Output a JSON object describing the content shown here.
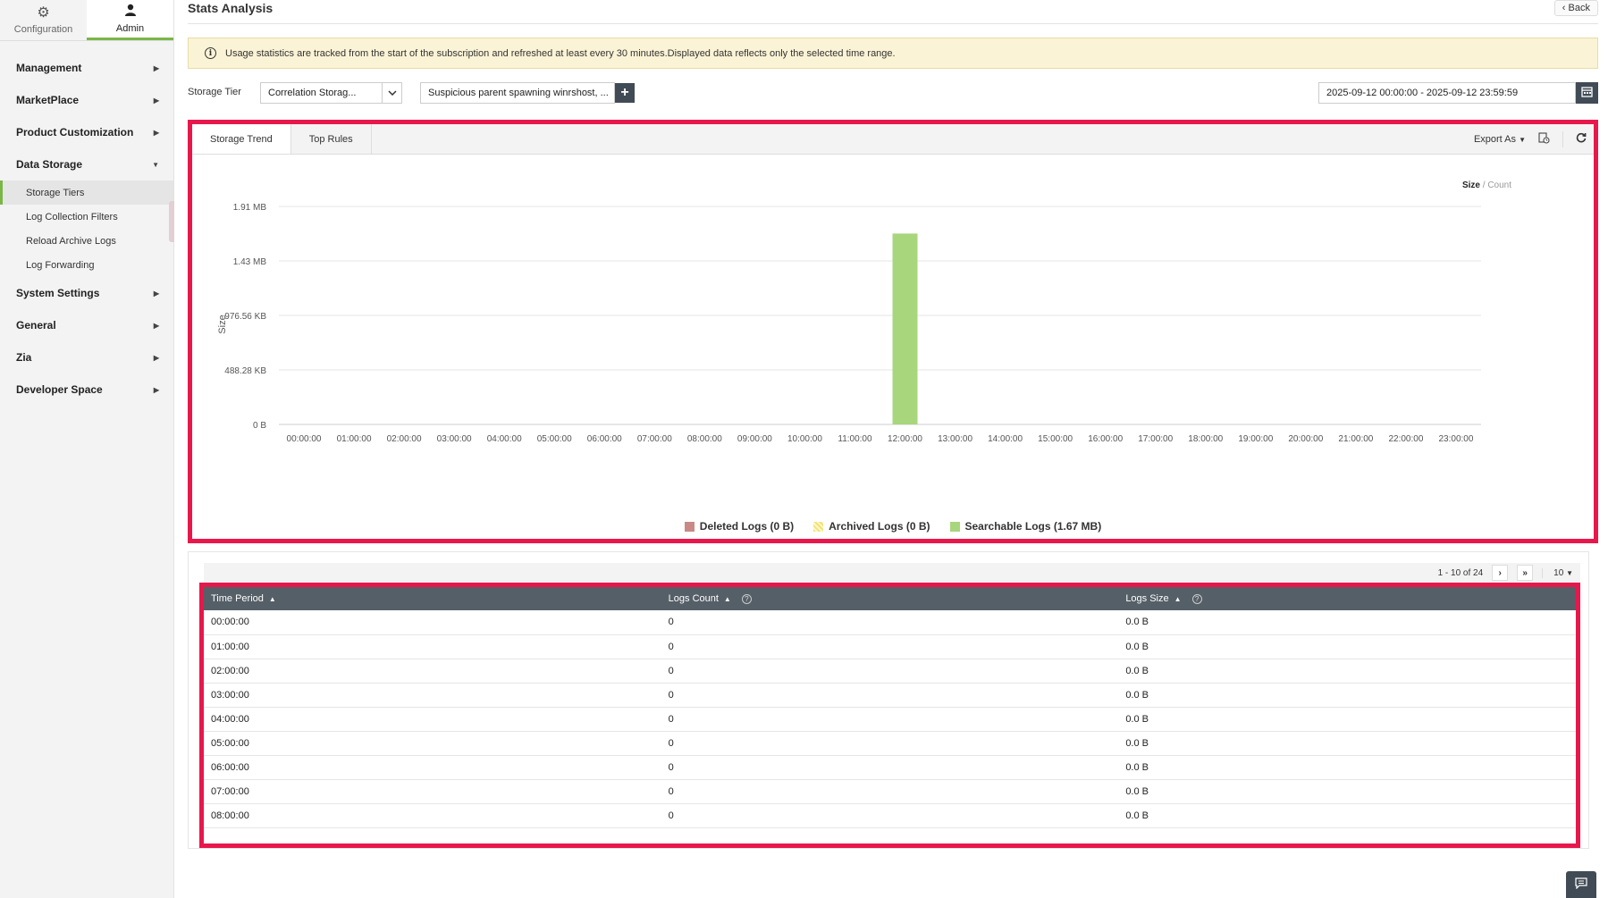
{
  "topnav": [
    {
      "label": "Configuration",
      "icon": "gear-icon",
      "active": false
    },
    {
      "label": "Admin",
      "icon": "user-icon",
      "active": true
    }
  ],
  "sidebar": {
    "items": [
      {
        "label": "Management"
      },
      {
        "label": "MarketPlace"
      },
      {
        "label": "Product Customization"
      },
      {
        "label": "Data Storage",
        "expanded": true
      },
      {
        "label": "System Settings"
      },
      {
        "label": "General"
      },
      {
        "label": "Zia"
      },
      {
        "label": "Developer Space"
      }
    ],
    "data_storage_children": [
      {
        "label": "Storage Tiers",
        "active": true
      },
      {
        "label": "Log Collection Filters"
      },
      {
        "label": "Reload Archive Logs"
      },
      {
        "label": "Log Forwarding"
      }
    ]
  },
  "header": {
    "title": "Stats Analysis",
    "back_label": "Back"
  },
  "banner": {
    "text": "Usage statistics are tracked from the start of the subscription and refreshed at least every 30 minutes.Displayed data reflects only the selected time range."
  },
  "filters": {
    "tier_label": "Storage Tier",
    "tier_value": "Correlation Storag...",
    "rule_value": "Suspicious parent spawning winrshost, ...",
    "plus_label": "+",
    "date_range": "2025-09-12 00:00:00 - 2025-09-12 23:59:59"
  },
  "tabs": [
    {
      "label": "Storage Trend",
      "active": true
    },
    {
      "label": "Top Rules",
      "active": false
    }
  ],
  "tools": {
    "export_label": "Export As"
  },
  "toggle": {
    "size": "Size",
    "sep": " / ",
    "count": "Count"
  },
  "colors": {
    "deleted": "#c98a86",
    "archived": "#f2e27a",
    "searchable": "#a8d67c",
    "highlight": "#e8174b",
    "accent": "#7ab648"
  },
  "chart_data": {
    "type": "bar",
    "stacked": true,
    "ylabel": "Size",
    "y_ticks": [
      "0 B",
      "488.28 KB",
      "976.56 KB",
      "1.43 MB",
      "1.91 MB"
    ],
    "ylim_bytes": [
      0,
      2000000
    ],
    "categories": [
      "00:00:00",
      "01:00:00",
      "02:00:00",
      "03:00:00",
      "04:00:00",
      "05:00:00",
      "06:00:00",
      "07:00:00",
      "08:00:00",
      "09:00:00",
      "10:00:00",
      "11:00:00",
      "12:00:00",
      "13:00:00",
      "14:00:00",
      "15:00:00",
      "16:00:00",
      "17:00:00",
      "18:00:00",
      "19:00:00",
      "20:00:00",
      "21:00:00",
      "22:00:00",
      "23:00:00"
    ],
    "series": [
      {
        "name": "Deleted Logs (0 B)",
        "color": "#c98a86",
        "values": [
          0,
          0,
          0,
          0,
          0,
          0,
          0,
          0,
          0,
          0,
          0,
          0,
          0,
          0,
          0,
          0,
          0,
          0,
          0,
          0,
          0,
          0,
          0,
          0
        ]
      },
      {
        "name": "Archived Logs (0 B)",
        "color": "#f2e27a",
        "values": [
          0,
          0,
          0,
          0,
          0,
          0,
          0,
          0,
          0,
          0,
          0,
          0,
          0,
          0,
          0,
          0,
          0,
          0,
          0,
          0,
          0,
          0,
          0,
          0
        ]
      },
      {
        "name": "Searchable Logs (1.67 MB)",
        "color": "#a8d67c",
        "values": [
          0,
          0,
          0,
          0,
          0,
          0,
          0,
          0,
          0,
          0,
          0,
          0,
          1751122,
          0,
          0,
          0,
          0,
          0,
          0,
          0,
          0,
          0,
          0,
          0
        ]
      }
    ],
    "grid": true,
    "legend_position": "bottom"
  },
  "pager": {
    "range": "1 - 10 of 24",
    "next": "›",
    "last": "»",
    "per_page": "10"
  },
  "table": {
    "headers": [
      "Time Period",
      "Logs Count",
      "Logs Size"
    ],
    "rows": [
      [
        "00:00:00",
        "0",
        "0.0 B"
      ],
      [
        "01:00:00",
        "0",
        "0.0 B"
      ],
      [
        "02:00:00",
        "0",
        "0.0 B"
      ],
      [
        "03:00:00",
        "0",
        "0.0 B"
      ],
      [
        "04:00:00",
        "0",
        "0.0 B"
      ],
      [
        "05:00:00",
        "0",
        "0.0 B"
      ],
      [
        "06:00:00",
        "0",
        "0.0 B"
      ],
      [
        "07:00:00",
        "0",
        "0.0 B"
      ],
      [
        "08:00:00",
        "0",
        "0.0 B"
      ]
    ]
  }
}
